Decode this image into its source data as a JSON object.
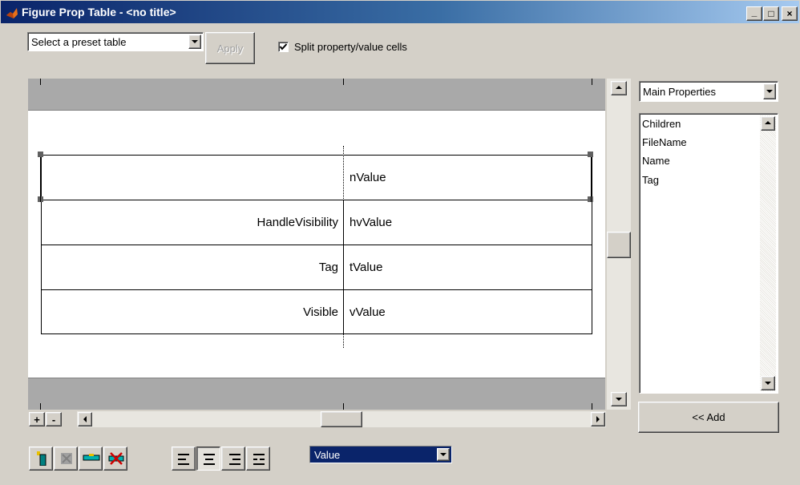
{
  "window": {
    "title": "Figure Prop Table - <no title>",
    "controls": {
      "minimize": "_",
      "maximize": "□",
      "close": "×"
    }
  },
  "toolbar": {
    "preset_select": "Select a preset table",
    "apply_label": "Apply",
    "split_checkbox_label": "Split property/value cells",
    "split_checked": true
  },
  "table": {
    "rows": [
      {
        "property": "",
        "value": "nValue"
      },
      {
        "property": "HandleVisibility",
        "value": "hvValue"
      },
      {
        "property": "Tag",
        "value": "tValue"
      },
      {
        "property": "Visible",
        "value": "vValue"
      }
    ]
  },
  "right_panel": {
    "category_select": "Main Properties",
    "list_items": [
      "Children",
      "FileName",
      "Name",
      "Tag"
    ],
    "add_label": "<< Add"
  },
  "bottom": {
    "plus_label": "+",
    "minus_label": "-",
    "value_select": "Value",
    "tools": [
      {
        "name": "insert-row-icon"
      },
      {
        "name": "delete-row-icon"
      },
      {
        "name": "merge-cells-icon"
      },
      {
        "name": "delete-table-icon"
      }
    ],
    "align_tools": [
      {
        "name": "align-left-icon",
        "pressed": false
      },
      {
        "name": "align-center-icon",
        "pressed": true
      },
      {
        "name": "align-right-icon",
        "pressed": false
      },
      {
        "name": "align-justify-icon",
        "pressed": false
      }
    ]
  },
  "colors": {
    "title_start": "#0a246a",
    "title_end": "#a6caf0",
    "face": "#d4d0c8",
    "band": "#a9a9a9",
    "selection": "#0a246a"
  }
}
